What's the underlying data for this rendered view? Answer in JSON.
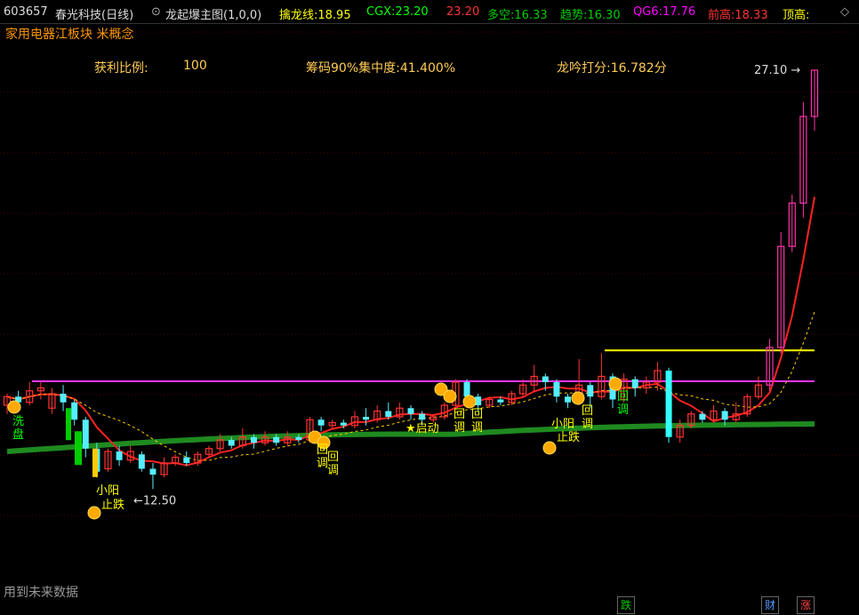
{
  "header": {
    "code": "603657",
    "name": "春光科技(日线)",
    "indicator": "龙起爆主图(1,0,0)",
    "items": [
      {
        "label": "擒龙线:",
        "value": "18.95",
        "color": "#ffff00"
      },
      {
        "label": "CGX:",
        "value": "23.20",
        "color": "#00ff00"
      },
      {
        "label": "",
        "value": "23.20",
        "color": "#ff3333"
      },
      {
        "label": "多空:",
        "value": "16.33",
        "color": "#00cc00"
      },
      {
        "label": "趋势:",
        "value": "16.30",
        "color": "#00cc00"
      },
      {
        "label": "QG6:",
        "value": "17.76",
        "color": "#ff00ff"
      },
      {
        "label": "前高:",
        "value": "18.33",
        "color": "#ff3333"
      },
      {
        "label": "顶高:",
        "value": "",
        "color": "#ffff00"
      }
    ]
  },
  "concept": "家用电器江板块 米概念",
  "stats": {
    "profit_label": "获利比例:",
    "profit_value": "100",
    "chip": "筹码90%集中度:41.400%",
    "score": "龙吟打分:16.782分"
  },
  "price_labels": {
    "high": "27.10",
    "low": "12.50"
  },
  "annotations": {
    "xipan": "洗盘",
    "xiaoyang": "小阳止跌",
    "huidiao": "回调",
    "qidong": "★启动",
    "huitiao": "回调"
  },
  "footer": {
    "note": "用到未来数据",
    "badge_die": "跌",
    "badge_cai": "财",
    "badge_zhang": "涨"
  },
  "chart_data": {
    "type": "candlestick",
    "high": 27.1,
    "low": 12.5,
    "resistance_level": 16.33,
    "candles": [
      [
        15.5,
        15.8,
        15.2,
        15.9
      ],
      [
        15.8,
        15.6,
        15.4,
        16.0
      ],
      [
        15.6,
        16.0,
        15.5,
        16.3
      ],
      [
        16.0,
        16.1,
        15.7,
        16.3
      ],
      [
        15.4,
        15.9,
        15.2,
        16.1
      ],
      [
        15.9,
        15.6,
        15.3,
        16.2
      ],
      [
        15.6,
        15.0,
        14.8,
        15.7
      ],
      [
        15.0,
        14.0,
        13.7,
        15.1
      ],
      [
        14.0,
        13.2,
        13.0,
        14.2
      ],
      [
        13.3,
        13.9,
        13.2,
        14.0
      ],
      [
        13.9,
        13.6,
        13.4,
        14.1
      ],
      [
        13.6,
        13.9,
        13.5,
        14.1
      ],
      [
        13.8,
        13.3,
        13.2,
        13.9
      ],
      [
        13.3,
        13.1,
        12.6,
        13.5
      ],
      [
        13.1,
        13.5,
        13.0,
        13.7
      ],
      [
        13.5,
        13.7,
        13.4,
        13.8
      ],
      [
        13.7,
        13.5,
        13.4,
        13.9
      ],
      [
        13.5,
        13.8,
        13.4,
        13.9
      ],
      [
        13.8,
        14.0,
        13.7,
        14.1
      ],
      [
        14.0,
        14.3,
        13.9,
        14.5
      ],
      [
        14.3,
        14.1,
        14.0,
        14.4
      ],
      [
        14.1,
        14.4,
        14.0,
        14.7
      ],
      [
        14.4,
        14.2,
        14.0,
        14.5
      ],
      [
        14.2,
        14.4,
        14.1,
        14.6
      ],
      [
        14.4,
        14.2,
        14.1,
        14.5
      ],
      [
        14.2,
        14.4,
        14.1,
        14.6
      ],
      [
        14.4,
        14.3,
        14.2,
        14.5
      ],
      [
        14.3,
        15.0,
        14.2,
        15.1
      ],
      [
        15.0,
        14.8,
        14.6,
        15.1
      ],
      [
        14.8,
        14.9,
        14.7,
        15.0
      ],
      [
        14.9,
        14.8,
        14.7,
        15.0
      ],
      [
        14.8,
        15.1,
        14.7,
        15.3
      ],
      [
        15.1,
        15.0,
        14.8,
        15.4
      ],
      [
        15.0,
        15.3,
        14.9,
        15.5
      ],
      [
        15.3,
        15.1,
        15.0,
        15.6
      ],
      [
        15.1,
        15.4,
        15.0,
        15.6
      ],
      [
        15.4,
        15.2,
        15.0,
        15.5
      ],
      [
        15.2,
        15.0,
        14.8,
        15.3
      ],
      [
        15.0,
        15.1,
        14.9,
        15.2
      ],
      [
        15.1,
        15.5,
        15.0,
        15.6
      ],
      [
        15.5,
        16.3,
        15.4,
        16.4
      ],
      [
        16.3,
        15.8,
        15.5,
        16.4
      ],
      [
        15.8,
        15.5,
        15.3,
        15.9
      ],
      [
        15.5,
        15.7,
        15.4,
        15.8
      ],
      [
        15.7,
        15.6,
        15.5,
        15.8
      ],
      [
        15.6,
        15.9,
        15.5,
        16.0
      ],
      [
        15.9,
        16.2,
        15.8,
        16.4
      ],
      [
        16.2,
        16.5,
        16.0,
        16.9
      ],
      [
        16.5,
        16.3,
        16.0,
        16.6
      ],
      [
        16.3,
        15.8,
        15.6,
        16.4
      ],
      [
        15.8,
        15.6,
        15.4,
        15.9
      ],
      [
        15.6,
        16.2,
        15.5,
        17.1
      ],
      [
        16.2,
        15.8,
        15.4,
        16.3
      ],
      [
        15.8,
        16.5,
        15.7,
        17.3
      ],
      [
        16.5,
        15.7,
        15.4,
        16.6
      ],
      [
        15.7,
        16.4,
        15.6,
        16.6
      ],
      [
        16.4,
        16.1,
        15.8,
        16.5
      ],
      [
        16.1,
        16.3,
        15.9,
        16.5
      ],
      [
        16.3,
        16.7,
        16.0,
        17.0
      ],
      [
        16.7,
        14.4,
        14.2,
        16.8
      ],
      [
        14.4,
        14.8,
        14.2,
        15.0
      ],
      [
        14.8,
        15.2,
        14.7,
        15.3
      ],
      [
        15.2,
        15.0,
        14.9,
        15.3
      ],
      [
        15.0,
        15.3,
        14.9,
        15.5
      ],
      [
        15.3,
        15.0,
        14.8,
        15.4
      ],
      [
        15.0,
        15.2,
        14.9,
        15.6
      ],
      [
        15.2,
        15.8,
        15.1,
        15.9
      ],
      [
        15.8,
        16.2,
        15.7,
        16.5
      ],
      [
        16.2,
        17.5,
        16.0,
        17.8
      ],
      [
        17.5,
        21.0,
        17.3,
        21.5
      ],
      [
        21.0,
        22.5,
        20.8,
        22.8
      ],
      [
        22.5,
        25.5,
        22.0,
        26.0
      ],
      [
        25.5,
        27.1,
        25.0,
        27.1
      ]
    ]
  }
}
